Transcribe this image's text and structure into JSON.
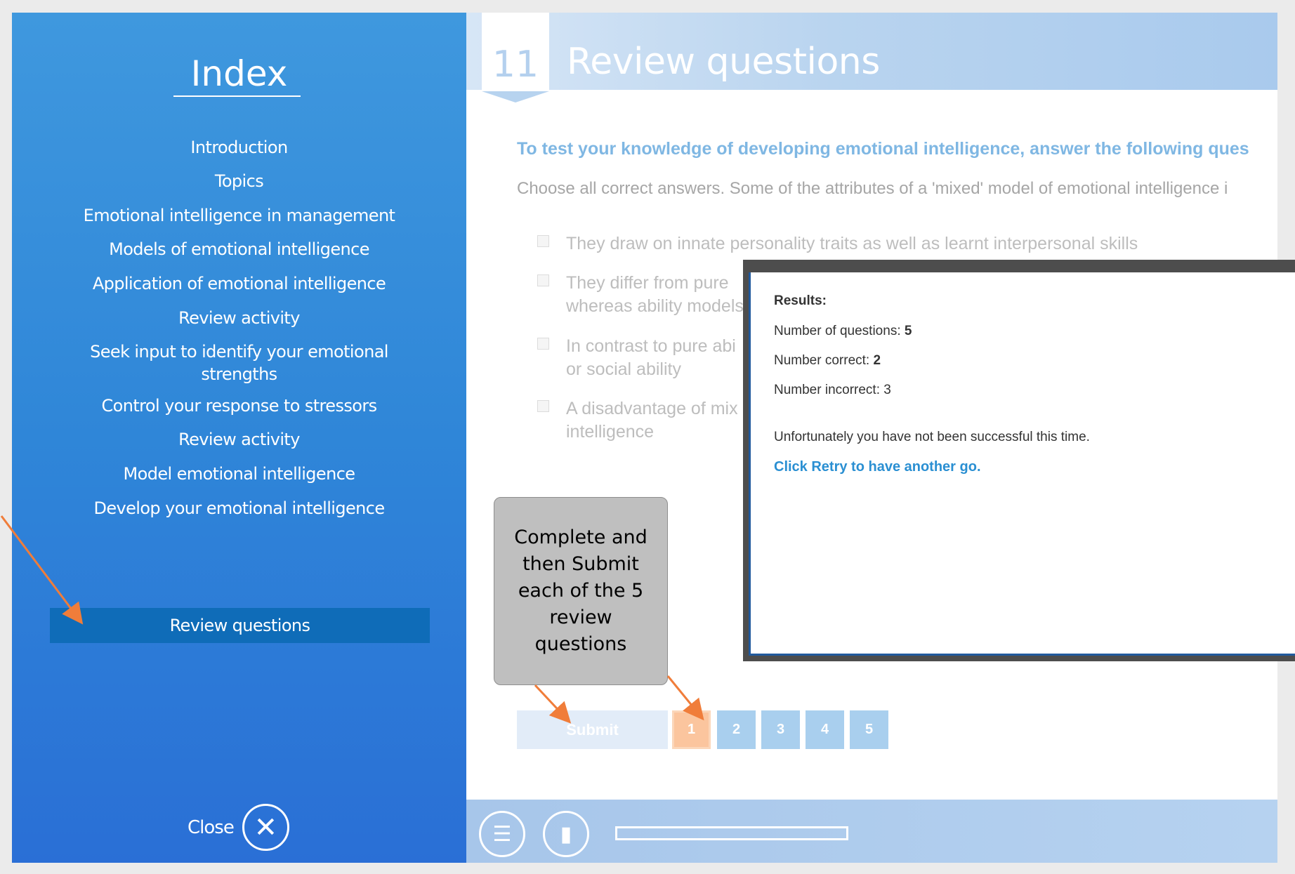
{
  "sidebar": {
    "title": "Index",
    "items": [
      {
        "label": "Introduction"
      },
      {
        "label": "Topics"
      },
      {
        "label": "Emotional intelligence in management"
      },
      {
        "label": "Models of emotional intelligence"
      },
      {
        "label": "Application of emotional intelligence"
      },
      {
        "label": "Review activity"
      },
      {
        "label": "Seek input to identify your emotional strengths"
      },
      {
        "label": "Control your response to stressors"
      },
      {
        "label": "Review activity"
      },
      {
        "label": "Model emotional intelligence"
      },
      {
        "label": "Develop your emotional intelligence"
      },
      {
        "label": "Review questions",
        "active": true
      }
    ],
    "close_label": "Close"
  },
  "header": {
    "lesson_number": "11",
    "title": "Review questions"
  },
  "question": {
    "instructions": "To test your knowledge of developing emotional intelligence, answer the following ques",
    "prompt": "Choose all correct answers. Some of the attributes of a 'mixed' model of emotional intelligence i",
    "options": [
      {
        "text": "They draw on innate personality traits as well as learnt interpersonal skills"
      },
      {
        "text": "They differ from pure",
        "text2": "whereas ability models"
      },
      {
        "text": "In contrast to pure abi",
        "text2": "or social ability"
      },
      {
        "text": "A disadvantage of mix",
        "text2": "intelligence"
      }
    ]
  },
  "callout": {
    "text": "Complete and then Submit each of the 5 review questions"
  },
  "pagination": {
    "submit_label": "Submit",
    "pages": [
      "1",
      "2",
      "3",
      "4",
      "5"
    ],
    "current": 0
  },
  "footer": {
    "progress_fraction": 0.0
  },
  "results": {
    "heading": "Results:",
    "questions_label": "Number of questions: ",
    "questions_value": "5",
    "correct_label": "Number correct: ",
    "correct_value": "2",
    "incorrect_label": "Number incorrect: ",
    "incorrect_value": "3",
    "fail_message": "Unfortunately you have not been successful this time.",
    "retry_message": "Click Retry to have another go."
  },
  "colors": {
    "sidebar_top": "#3f98de",
    "sidebar_bottom": "#2a6fd6",
    "active_item": "#0f6cb8",
    "accent_orange": "#f07d3a",
    "link_blue": "#2a8fd2"
  }
}
